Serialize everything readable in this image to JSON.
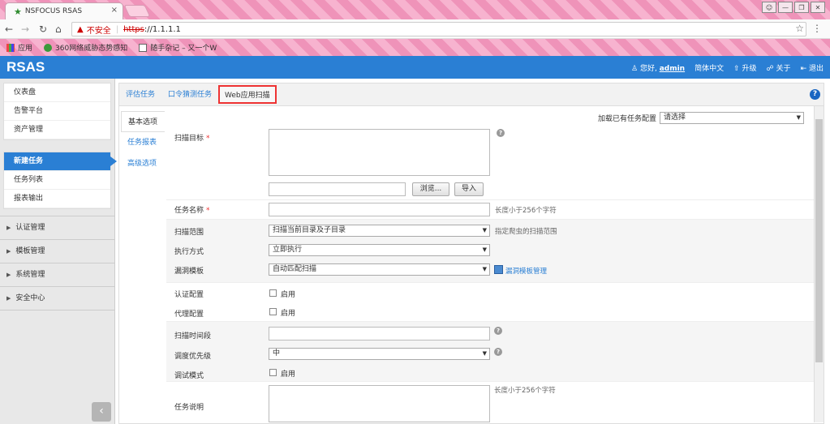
{
  "browser": {
    "tab_title": "NSFOCUS RSAS",
    "tab_close": "×",
    "insecure_label": "不安全",
    "url_scheme": "https",
    "url_rest": "://1.1.1.1",
    "bookmarks": [
      {
        "label": "应用"
      },
      {
        "label": "360网络威胁态势感知"
      },
      {
        "label": "随手杂记 – 又一个W"
      }
    ]
  },
  "app": {
    "logo": "RSAS",
    "greeting": "您好,",
    "user": "admin",
    "lang": "简体中文",
    "upgrade": "升级",
    "about": "关于",
    "logout": "退出"
  },
  "sidebar": {
    "group1": [
      "仪表盘",
      "告警平台",
      "资产管理"
    ],
    "group2": [
      "新建任务",
      "任务列表",
      "报表输出"
    ],
    "sections": [
      "认证管理",
      "模板管理",
      "系统管理",
      "安全中心"
    ],
    "collapse": "‹"
  },
  "tabs": [
    "评估任务",
    "口令猜测任务",
    "Web应用扫描"
  ],
  "subnav": [
    "基本选项",
    "任务报表",
    "高级选项"
  ],
  "form": {
    "load_config_label": "加载已有任务配置",
    "load_config_value": "请选择",
    "scan_target": "扫描目标",
    "browse": "浏览...",
    "import": "导入",
    "task_name": "任务名称",
    "task_name_hint": "长度小于256个字符",
    "scan_scope": "扫描范围",
    "scan_scope_value": "扫描当前目录及子目录",
    "scan_scope_hint": "指定爬虫的扫描范围",
    "exec_mode": "执行方式",
    "exec_mode_value": "立即执行",
    "vuln_template": "漏洞模板",
    "vuln_template_value": "自动匹配扫描",
    "vuln_template_link": "漏洞模板管理",
    "auth_config": "认证配置",
    "enable": "启用",
    "proxy_config": "代理配置",
    "scan_period": "扫描时间段",
    "priority": "调度优先级",
    "priority_value": "中",
    "debug_mode": "调试模式",
    "task_desc": "任务说明",
    "task_desc_hint": "长度小于256个字符"
  }
}
